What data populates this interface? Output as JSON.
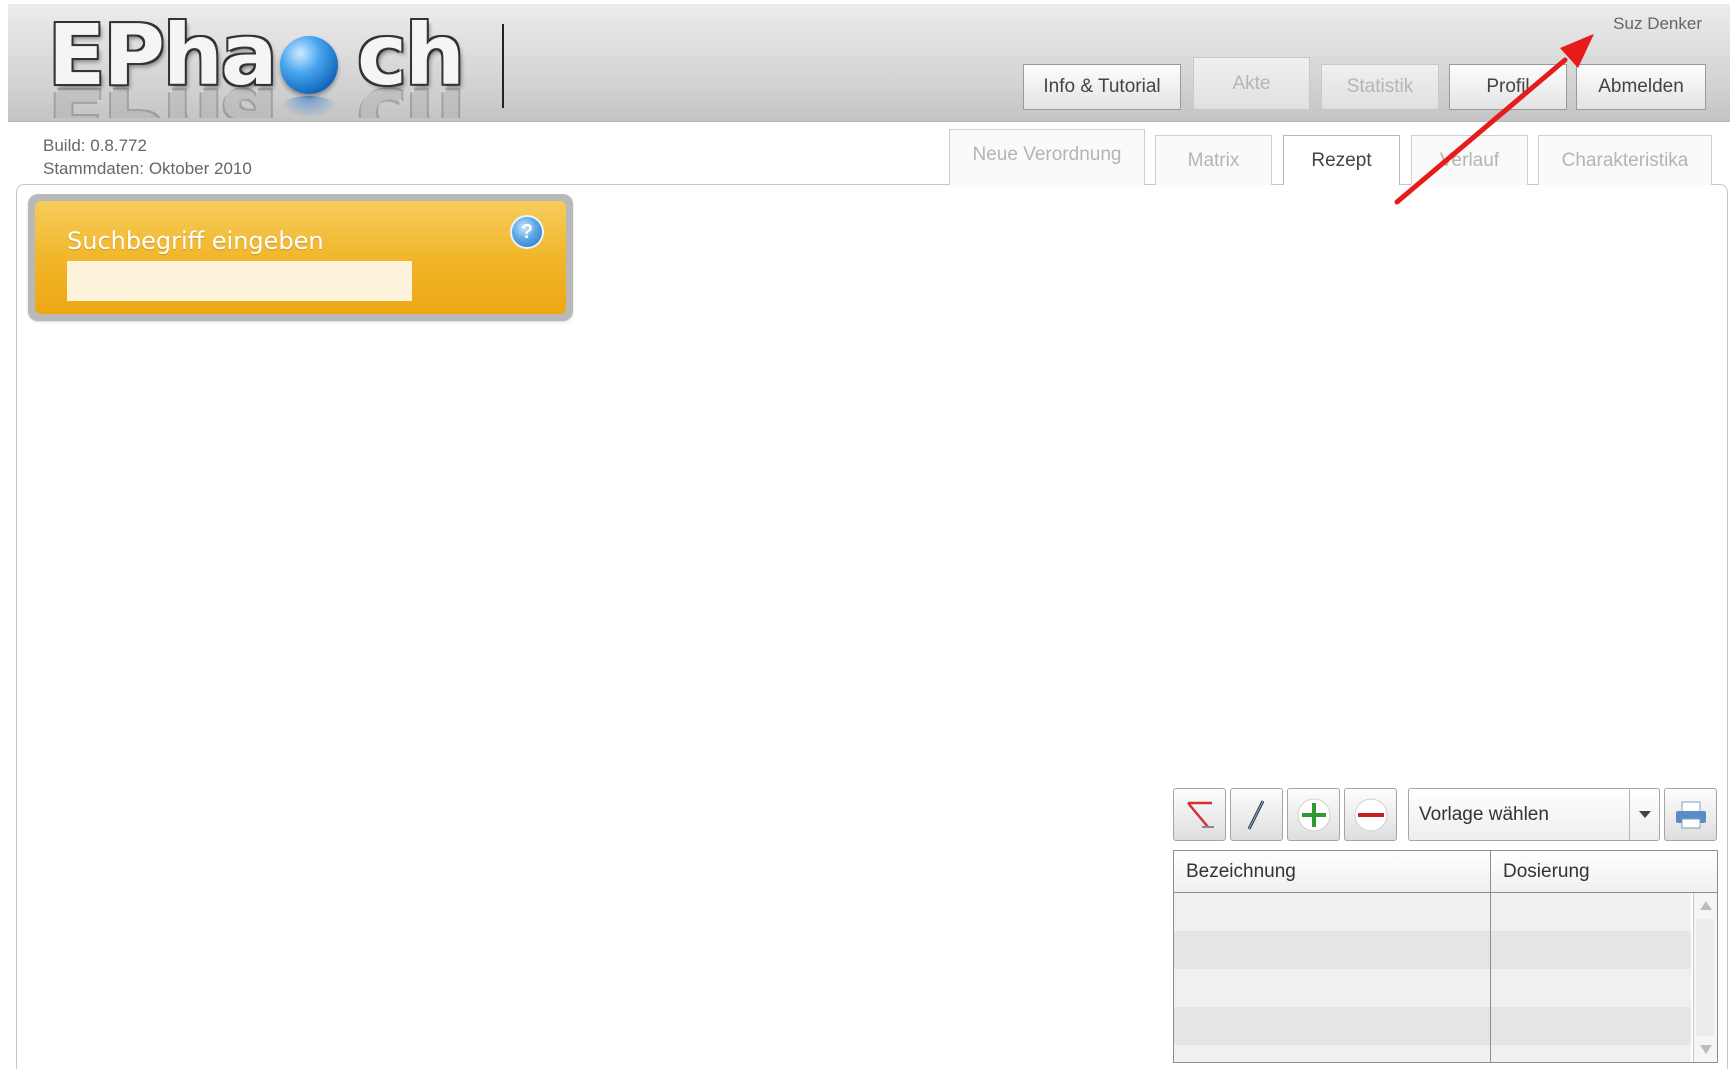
{
  "header": {
    "logo_text": "EPha ch",
    "user_name": "Suz Denker",
    "nav_buttons": [
      {
        "label": "Info & Tutorial",
        "enabled": true
      },
      {
        "label": "Akte",
        "enabled": false
      },
      {
        "label": "Statistik",
        "enabled": false
      },
      {
        "label": "Profil",
        "enabled": true
      },
      {
        "label": "Abmelden",
        "enabled": true
      }
    ]
  },
  "build_info": {
    "build": "Build: 0.8.772",
    "stammdaten": "Stammdaten: Oktober 2010"
  },
  "tabs": [
    {
      "label": "Neue Verordnung",
      "active": false
    },
    {
      "label": "Matrix",
      "active": false
    },
    {
      "label": "Rezept",
      "active": true
    },
    {
      "label": "Verlauf",
      "active": false
    },
    {
      "label": "Charakteristika",
      "active": false
    }
  ],
  "search": {
    "title": "Suchbegriff eingeben",
    "value": "",
    "help_icon": "question-mark"
  },
  "toolbar": {
    "icons": [
      "clear-icon",
      "edit-pencil-icon",
      "add-plus-icon",
      "remove-minus-icon",
      "print-icon"
    ],
    "template_select": "Vorlage wählen"
  },
  "prescription_table": {
    "columns": [
      "Bezeichnung",
      "Dosierung"
    ],
    "rows": []
  },
  "colors": {
    "search_panel": "#f2b62b",
    "annotation_arrow": "#e61b1b"
  }
}
